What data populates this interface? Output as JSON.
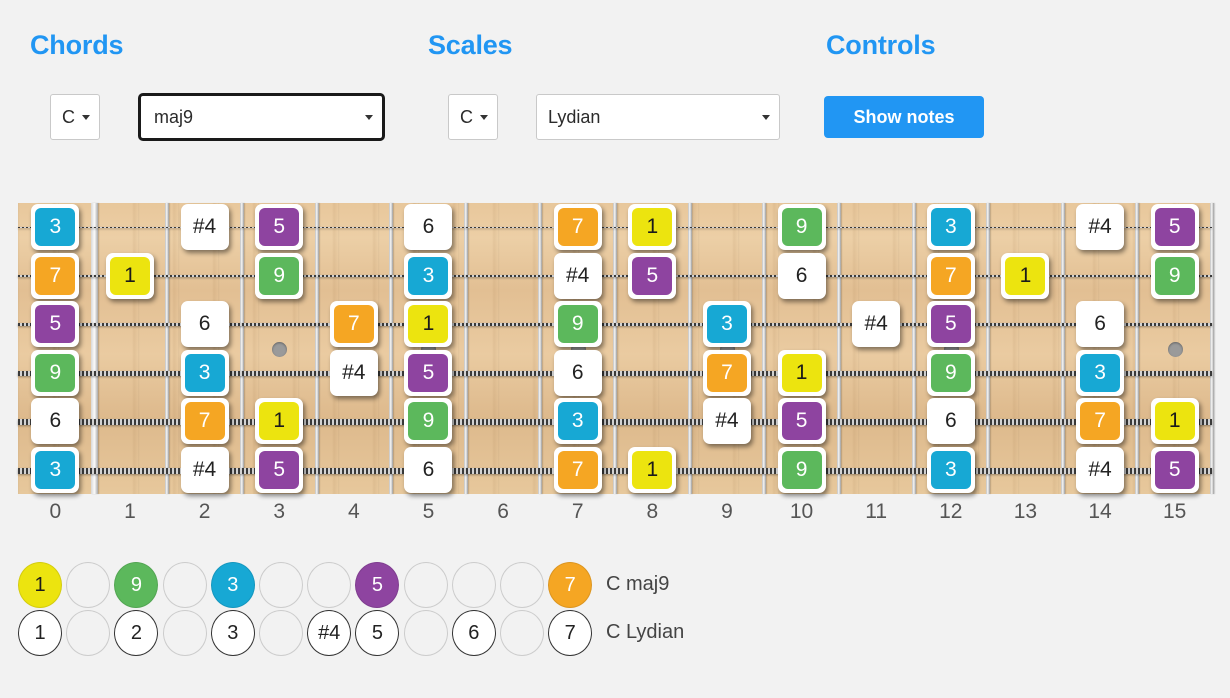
{
  "groups": {
    "chords_heading": "Chords",
    "scales_heading": "Scales",
    "controls_heading": "Controls"
  },
  "chord": {
    "root": "C",
    "type": "maj9",
    "name": "C maj9"
  },
  "scale": {
    "root": "C",
    "type": "Lydian",
    "name": "C Lydian"
  },
  "controls": {
    "show_notes_label": "Show notes"
  },
  "colors": {
    "accent": "#2196f3",
    "degree_1": "#ece40f",
    "degree_9": "#5cb85c",
    "degree_3": "#17a8d4",
    "degree_5": "#8e44a0",
    "degree_7": "#f5a623",
    "plain": "#ffffff",
    "page_bg": "#f2f2f2"
  },
  "fretboard": {
    "fret_numbers": [
      "0",
      "1",
      "2",
      "3",
      "4",
      "5",
      "6",
      "7",
      "8",
      "9",
      "10",
      "11",
      "12",
      "13",
      "14",
      "15"
    ],
    "first_fret": 0,
    "last_fret": 15,
    "inlay_frets": [
      3,
      5,
      7,
      9,
      12,
      15
    ],
    "string_count": 6,
    "strings": [
      {
        "name": "string-1-high-e",
        "notes": [
          {
            "fret": 0,
            "label": "3",
            "degree": "3"
          },
          {
            "fret": 2,
            "label": "#4",
            "degree": "plain"
          },
          {
            "fret": 3,
            "label": "5",
            "degree": "5"
          },
          {
            "fret": 5,
            "label": "6",
            "degree": "plain"
          },
          {
            "fret": 7,
            "label": "7",
            "degree": "7"
          },
          {
            "fret": 8,
            "label": "1",
            "degree": "1"
          },
          {
            "fret": 10,
            "label": "9",
            "degree": "9"
          },
          {
            "fret": 12,
            "label": "3",
            "degree": "3"
          },
          {
            "fret": 14,
            "label": "#4",
            "degree": "plain"
          },
          {
            "fret": 15,
            "label": "5",
            "degree": "5"
          }
        ]
      },
      {
        "name": "string-2-b",
        "notes": [
          {
            "fret": 0,
            "label": "7",
            "degree": "7"
          },
          {
            "fret": 1,
            "label": "1",
            "degree": "1"
          },
          {
            "fret": 3,
            "label": "9",
            "degree": "9"
          },
          {
            "fret": 5,
            "label": "3",
            "degree": "3"
          },
          {
            "fret": 7,
            "label": "#4",
            "degree": "plain"
          },
          {
            "fret": 8,
            "label": "5",
            "degree": "5"
          },
          {
            "fret": 10,
            "label": "6",
            "degree": "plain"
          },
          {
            "fret": 12,
            "label": "7",
            "degree": "7"
          },
          {
            "fret": 13,
            "label": "1",
            "degree": "1"
          },
          {
            "fret": 15,
            "label": "9",
            "degree": "9"
          }
        ]
      },
      {
        "name": "string-3-g",
        "notes": [
          {
            "fret": 0,
            "label": "5",
            "degree": "5"
          },
          {
            "fret": 2,
            "label": "6",
            "degree": "plain"
          },
          {
            "fret": 4,
            "label": "7",
            "degree": "7"
          },
          {
            "fret": 5,
            "label": "1",
            "degree": "1"
          },
          {
            "fret": 7,
            "label": "9",
            "degree": "9"
          },
          {
            "fret": 9,
            "label": "3",
            "degree": "3"
          },
          {
            "fret": 11,
            "label": "#4",
            "degree": "plain"
          },
          {
            "fret": 12,
            "label": "5",
            "degree": "5"
          },
          {
            "fret": 14,
            "label": "6",
            "degree": "plain"
          }
        ]
      },
      {
        "name": "string-4-d",
        "notes": [
          {
            "fret": 0,
            "label": "9",
            "degree": "9"
          },
          {
            "fret": 2,
            "label": "3",
            "degree": "3"
          },
          {
            "fret": 4,
            "label": "#4",
            "degree": "plain"
          },
          {
            "fret": 5,
            "label": "5",
            "degree": "5"
          },
          {
            "fret": 7,
            "label": "6",
            "degree": "plain"
          },
          {
            "fret": 9,
            "label": "7",
            "degree": "7"
          },
          {
            "fret": 10,
            "label": "1",
            "degree": "1"
          },
          {
            "fret": 12,
            "label": "9",
            "degree": "9"
          },
          {
            "fret": 14,
            "label": "3",
            "degree": "3"
          }
        ]
      },
      {
        "name": "string-5-a",
        "notes": [
          {
            "fret": 0,
            "label": "6",
            "degree": "plain"
          },
          {
            "fret": 2,
            "label": "7",
            "degree": "7"
          },
          {
            "fret": 3,
            "label": "1",
            "degree": "1"
          },
          {
            "fret": 5,
            "label": "9",
            "degree": "9"
          },
          {
            "fret": 7,
            "label": "3",
            "degree": "3"
          },
          {
            "fret": 9,
            "label": "#4",
            "degree": "plain"
          },
          {
            "fret": 10,
            "label": "5",
            "degree": "5"
          },
          {
            "fret": 12,
            "label": "6",
            "degree": "plain"
          },
          {
            "fret": 14,
            "label": "7",
            "degree": "7"
          },
          {
            "fret": 15,
            "label": "1",
            "degree": "1"
          }
        ]
      },
      {
        "name": "string-6-low-e",
        "notes": [
          {
            "fret": 0,
            "label": "3",
            "degree": "3"
          },
          {
            "fret": 2,
            "label": "#4",
            "degree": "plain"
          },
          {
            "fret": 3,
            "label": "5",
            "degree": "5"
          },
          {
            "fret": 5,
            "label": "6",
            "degree": "plain"
          },
          {
            "fret": 7,
            "label": "7",
            "degree": "7"
          },
          {
            "fret": 8,
            "label": "1",
            "degree": "1"
          },
          {
            "fret": 10,
            "label": "9",
            "degree": "9"
          },
          {
            "fret": 12,
            "label": "3",
            "degree": "3"
          },
          {
            "fret": 14,
            "label": "#4",
            "degree": "plain"
          },
          {
            "fret": 15,
            "label": "5",
            "degree": "5"
          }
        ]
      }
    ]
  },
  "legend": {
    "rows": [
      {
        "name": "chord-legend-row",
        "label": "C maj9",
        "slots": [
          {
            "label": "1",
            "degree": "1"
          },
          {
            "label": "",
            "degree": "empty"
          },
          {
            "label": "9",
            "degree": "9"
          },
          {
            "label": "",
            "degree": "empty"
          },
          {
            "label": "3",
            "degree": "3"
          },
          {
            "label": "",
            "degree": "empty"
          },
          {
            "label": "",
            "degree": "empty"
          },
          {
            "label": "5",
            "degree": "5"
          },
          {
            "label": "",
            "degree": "empty"
          },
          {
            "label": "",
            "degree": "empty"
          },
          {
            "label": "",
            "degree": "empty"
          },
          {
            "label": "7",
            "degree": "7"
          }
        ]
      },
      {
        "name": "scale-legend-row",
        "label": "C Lydian",
        "slots": [
          {
            "label": "1",
            "degree": "open"
          },
          {
            "label": "",
            "degree": "empty"
          },
          {
            "label": "2",
            "degree": "open"
          },
          {
            "label": "",
            "degree": "empty"
          },
          {
            "label": "3",
            "degree": "open"
          },
          {
            "label": "",
            "degree": "empty"
          },
          {
            "label": "#4",
            "degree": "open"
          },
          {
            "label": "5",
            "degree": "open"
          },
          {
            "label": "",
            "degree": "empty"
          },
          {
            "label": "6",
            "degree": "open"
          },
          {
            "label": "",
            "degree": "empty"
          },
          {
            "label": "7",
            "degree": "open"
          }
        ]
      }
    ]
  }
}
